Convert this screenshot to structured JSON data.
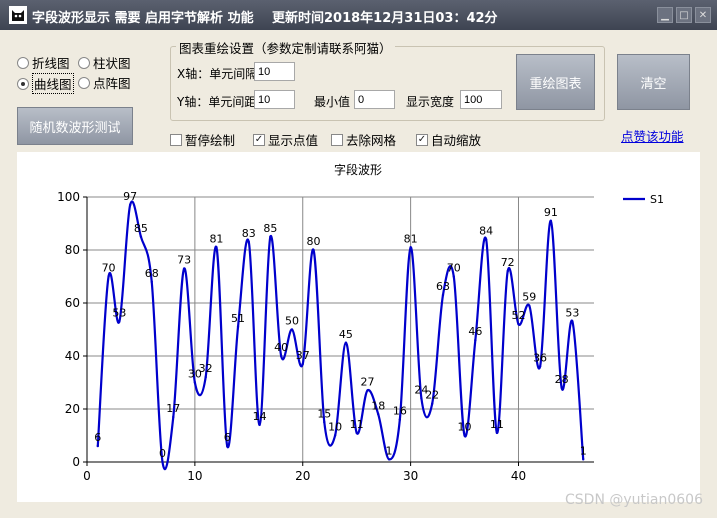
{
  "window": {
    "title": "字段波形显示 需要 启用字节解析 功能",
    "update_time": "更新时间2018年12月31日03：42分"
  },
  "chart_type_options": {
    "line": "折线图",
    "bar": "柱状图",
    "curve": "曲线图",
    "scatter": "点阵图",
    "selected": "curve"
  },
  "buttons": {
    "random_test": "随机数波形测试",
    "redraw": "重绘图表",
    "clear": "清空"
  },
  "settings_group": {
    "title": "图表重绘设置（参数定制请联系阿猫）",
    "x_interval_label": "X轴：单元间隔",
    "x_interval_value": "10",
    "y_interval_label": "Y轴：单元间距",
    "y_interval_value": "10",
    "min_label": "最小值",
    "min_value": "0",
    "width_label": "显示宽度",
    "width_value": "100"
  },
  "options": {
    "pause": {
      "label": "暂停绘制",
      "checked": false
    },
    "show_values": {
      "label": "显示点值",
      "checked": true
    },
    "remove_grid": {
      "label": "去除网格",
      "checked": false
    },
    "auto_zoom": {
      "label": "自动缩放",
      "checked": true
    }
  },
  "link": {
    "label": "点赞该功能"
  },
  "watermark": "CSDN @yutian0606",
  "colors": {
    "series": "#0000cc",
    "grid": "#888888"
  },
  "chart_data": {
    "type": "line",
    "smooth": true,
    "title": "字段波形",
    "xlim": [
      0,
      47
    ],
    "ylim": [
      0,
      100
    ],
    "x_ticks": [
      0,
      10,
      20,
      30,
      40
    ],
    "y_ticks": [
      0,
      20,
      40,
      60,
      80,
      100
    ],
    "grid": true,
    "legend_position": "top-right",
    "series": [
      {
        "name": "S1",
        "x": [
          1,
          2,
          3,
          4,
          5,
          6,
          7,
          8,
          9,
          10,
          11,
          12,
          13,
          14,
          15,
          16,
          17,
          18,
          19,
          20,
          21,
          22,
          23,
          24,
          25,
          26,
          27,
          28,
          29,
          30,
          31,
          32,
          33,
          34,
          35,
          36,
          37,
          38,
          39,
          40,
          41,
          42,
          43,
          44,
          45,
          46
        ],
        "values": [
          6,
          70,
          53,
          97,
          85,
          68,
          0,
          17,
          73,
          30,
          32,
          81,
          6,
          51,
          83,
          14,
          85,
          40,
          50,
          37,
          80,
          15,
          10,
          45,
          11,
          27,
          18,
          1,
          16,
          81,
          24,
          22,
          63,
          70,
          10,
          46,
          84,
          11,
          72,
          52,
          59,
          36,
          91,
          28,
          53,
          1
        ]
      }
    ]
  }
}
